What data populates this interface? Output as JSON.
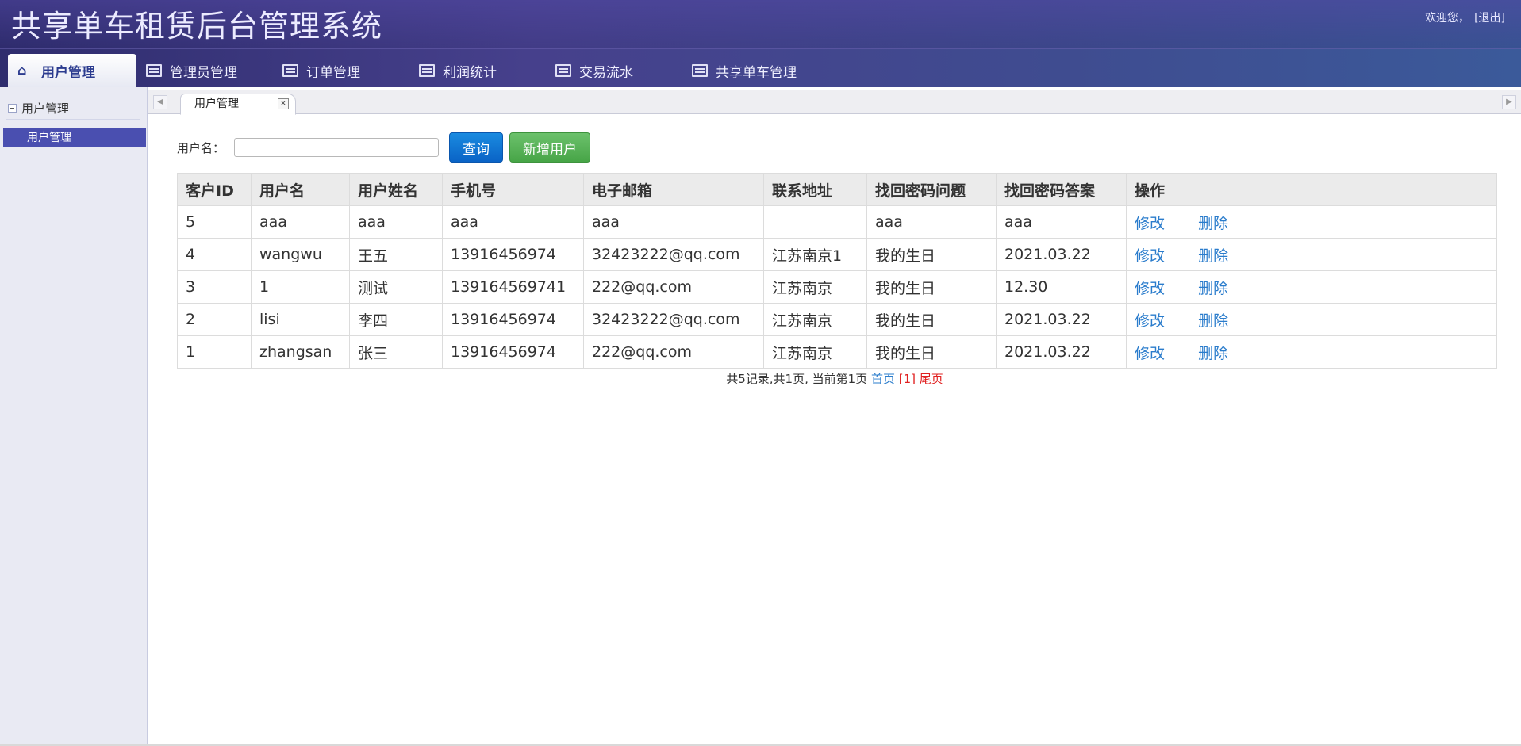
{
  "app": {
    "title": "共享单车租赁后台管理系统",
    "welcome": "欢迎您，",
    "logout": "[退出]"
  },
  "nav": {
    "tabs": [
      {
        "label": "用户管理",
        "icon": "home-icon",
        "active": true
      },
      {
        "label": "管理员管理",
        "icon": "list-icon"
      },
      {
        "label": "订单管理",
        "icon": "list-icon"
      },
      {
        "label": "利润统计",
        "icon": "list-icon"
      },
      {
        "label": "交易流水",
        "icon": "list-icon"
      },
      {
        "label": "共享单车管理",
        "icon": "list-icon"
      }
    ]
  },
  "sidebar": {
    "heading": "用户管理",
    "items": [
      {
        "label": "用户管理",
        "active": true
      }
    ]
  },
  "content_tab": {
    "label": "用户管理",
    "close": "×"
  },
  "search": {
    "label": "用户名：",
    "value": "",
    "placeholder": "",
    "query_button": "查询",
    "add_button": "新增用户"
  },
  "table": {
    "headers": [
      "客户ID",
      "用户名",
      "用户姓名",
      "手机号",
      "电子邮箱",
      "联系地址",
      "找回密码问题",
      "找回密码答案",
      "操作"
    ],
    "rows": [
      [
        "5",
        "aaa",
        "aaa",
        "aaa",
        "aaa",
        "",
        "aaa",
        "aaa"
      ],
      [
        "4",
        "wangwu",
        "王五",
        "13916456974",
        "32423222@qq.com",
        "江苏南京1",
        "我的生日",
        "2021.03.22"
      ],
      [
        "3",
        "1",
        "测试",
        "139164569741",
        "222@qq.com",
        "江苏南京",
        "我的生日",
        "12.30"
      ],
      [
        "2",
        "lisi",
        "李四",
        "13916456974",
        "32423222@qq.com",
        "江苏南京",
        "我的生日",
        "2021.03.22"
      ],
      [
        "1",
        "zhangsan",
        "张三",
        "13916456974",
        "222@qq.com",
        "江苏南京",
        "我的生日",
        "2021.03.22"
      ]
    ],
    "edit_label": "修改",
    "delete_label": "删除"
  },
  "pager": {
    "summary": "共5记录,共1页, 当前第1页",
    "first": "首页",
    "current": "[1]",
    "last": "尾页"
  },
  "colors": {
    "header_dark": "#2f2d6e",
    "accent_blue": "#4a4fb0",
    "link": "#2a7ccc",
    "primary_button": "#0a63c6",
    "success_button": "#47a547",
    "pager_red": "#e02020"
  }
}
